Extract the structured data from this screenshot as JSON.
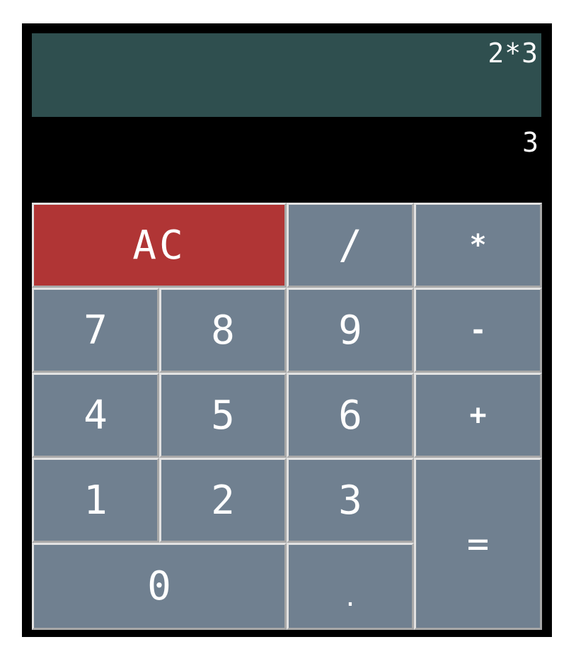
{
  "display": {
    "expression": "2*3",
    "result": "3"
  },
  "keys": {
    "clear": "AC",
    "divide": "/",
    "multiply": "*",
    "seven": "7",
    "eight": "8",
    "nine": "9",
    "subtract": "-",
    "four": "4",
    "five": "5",
    "six": "6",
    "add": "+",
    "one": "1",
    "two": "2",
    "three": "3",
    "equals": "=",
    "zero": "0",
    "decimal": "."
  },
  "colors": {
    "frame": "#000000",
    "expression_bg": "#2f4f4f",
    "key_bg": "#708090",
    "clear_bg": "#b03535",
    "text": "#ffffff"
  }
}
